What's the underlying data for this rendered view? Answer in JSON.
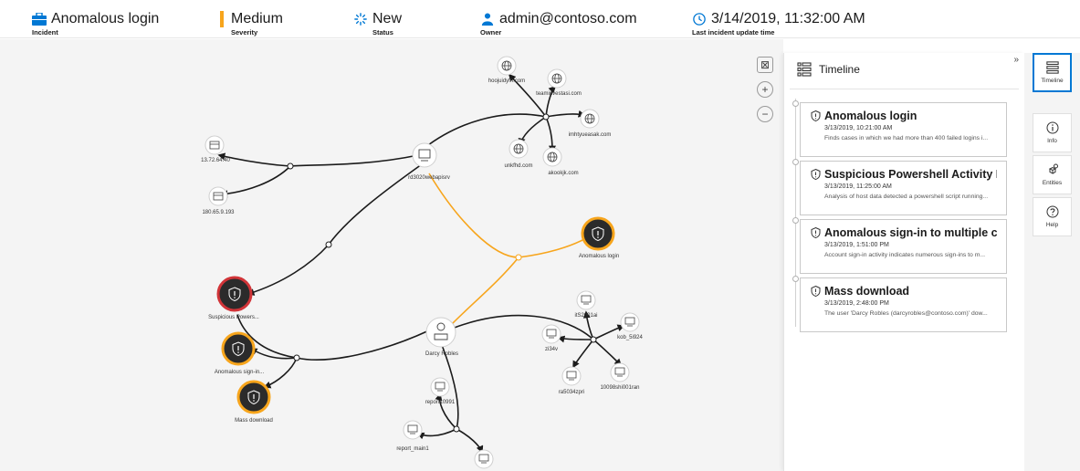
{
  "header": {
    "incident": {
      "value": "Anomalous login",
      "label": "Incident"
    },
    "severity": {
      "value": "Medium",
      "label": "Severity"
    },
    "status": {
      "value": "New",
      "label": "Status"
    },
    "owner": {
      "value": "admin@contoso.com",
      "label": "Owner"
    },
    "updated": {
      "value": "3/14/2019, 11:32:00 AM",
      "label": "Last incident update time"
    }
  },
  "graph": {
    "nodes": {
      "hoojuidy": "hoojuidyfh.com",
      "teamin": "teaminvestasi.com",
      "imhty": "imhtyueasak.com",
      "unkf": "unkfhd.com",
      "akoo": "akookjk.com",
      "rd": "rd3020webapisrv",
      "ip1": "13.72.64.40",
      "ip2": "180.65.9.193",
      "anomalous": "Anomalous login",
      "suspicious": "Suspicious Powers...",
      "anom_sign": "Anomalous sign-in...",
      "mass": "Mass download",
      "darcy": "Darcy Robles",
      "it": "itS2001ai",
      "zi": "zi34v",
      "kob": "kob_5i924",
      "ra": "ra5034zpri",
      "h100": "10098shi001ran",
      "rep10991": "report10991",
      "repmain": "report_main1"
    }
  },
  "panel": {
    "title": "Timeline",
    "collapse": "»",
    "events": [
      {
        "title": "Anomalous login",
        "date": "3/13/2019, 10:21:00 AM",
        "desc": "Finds cases in which we had more than 400 failed logins i..."
      },
      {
        "title": "Suspicious Powershell Activity Detec...",
        "date": "3/13/2019, 11:25:00 AM",
        "desc": "Analysis of host data detected a powershell script running..."
      },
      {
        "title": "Anomalous sign-in to multiple comp...",
        "date": "3/13/2019, 1:51:00 PM",
        "desc": "Account sign-in activity indicates numerous sign-ins to m..."
      },
      {
        "title": "Mass download",
        "date": "3/13/2019, 2:48:00 PM",
        "desc": "The user 'Darcy Robles (darcyrobles@contoso.com)' dow..."
      }
    ]
  },
  "rail": {
    "timeline": "Timeline",
    "info": "Info",
    "entities": "Entities",
    "help": "Help"
  },
  "zoom": {
    "fit": "⊠",
    "in": "+",
    "out": "−"
  },
  "colors": {
    "accent": "#0078d4",
    "severity_medium": "#f7a51c",
    "alert_ring_red": "#d13438",
    "edge_orange": "#f7a51c"
  }
}
